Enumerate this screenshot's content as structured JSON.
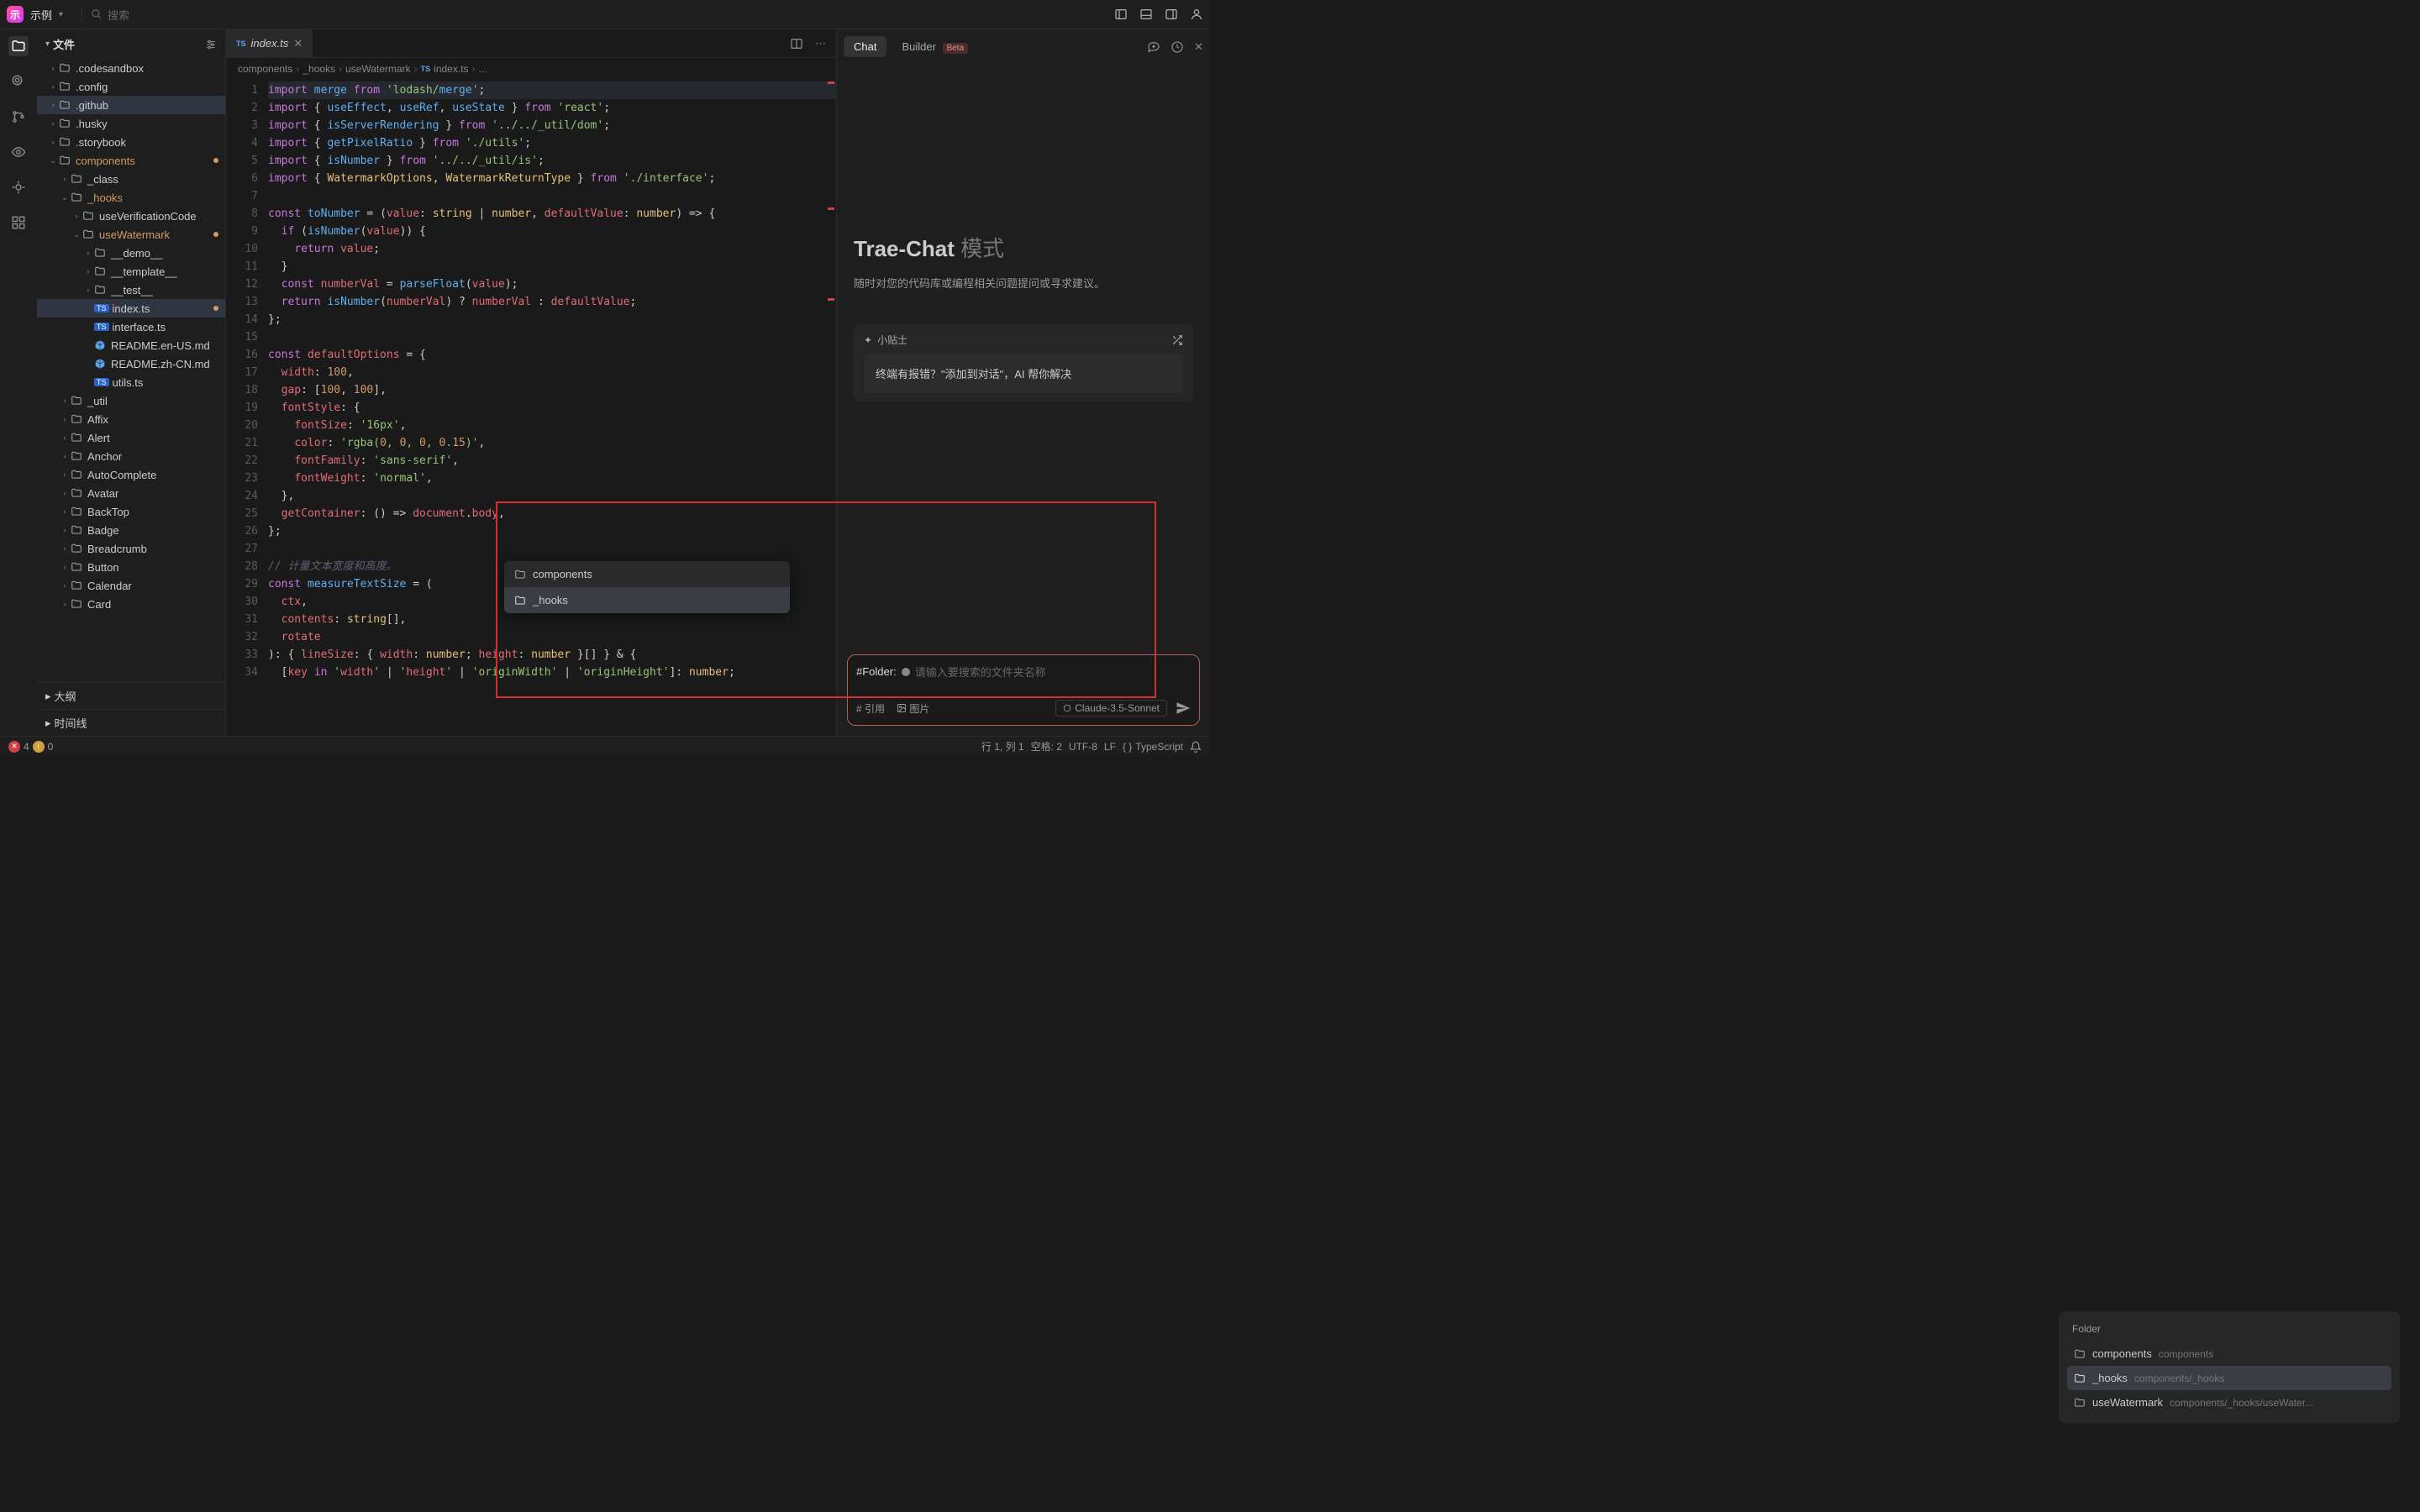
{
  "topbar": {
    "app_name": "示例",
    "search_placeholder": "搜索"
  },
  "sidebar": {
    "title": "文件",
    "tree": [
      {
        "type": "folder",
        "label": ".codesandbox",
        "depth": 0,
        "open": false
      },
      {
        "type": "folder",
        "label": ".config",
        "depth": 0,
        "open": false
      },
      {
        "type": "folder",
        "label": ".github",
        "depth": 0,
        "open": false,
        "selected": true
      },
      {
        "type": "folder",
        "label": ".husky",
        "depth": 0,
        "open": false
      },
      {
        "type": "folder",
        "label": ".storybook",
        "depth": 0,
        "open": false
      },
      {
        "type": "folder",
        "label": "components",
        "depth": 0,
        "open": true,
        "orange": true,
        "modified": true
      },
      {
        "type": "folder",
        "label": "_class",
        "depth": 1,
        "open": false
      },
      {
        "type": "folder",
        "label": "_hooks",
        "depth": 1,
        "open": true,
        "orange": true
      },
      {
        "type": "folder",
        "label": "useVerificationCode",
        "depth": 2,
        "open": false
      },
      {
        "type": "folder",
        "label": "useWatermark",
        "depth": 2,
        "open": true,
        "orange": true,
        "modified": true
      },
      {
        "type": "folder",
        "label": "__demo__",
        "depth": 3,
        "open": false
      },
      {
        "type": "folder",
        "label": "__template__",
        "depth": 3,
        "open": false
      },
      {
        "type": "folder",
        "label": "__test__",
        "depth": 3,
        "open": false
      },
      {
        "type": "file",
        "label": "index.ts",
        "depth": 3,
        "badge": "TS",
        "selected": true,
        "modified": true
      },
      {
        "type": "file",
        "label": "interface.ts",
        "depth": 3,
        "badge": "TS"
      },
      {
        "type": "file",
        "label": "README.en-US.md",
        "depth": 3,
        "icon": "md"
      },
      {
        "type": "file",
        "label": "README.zh-CN.md",
        "depth": 3,
        "icon": "md"
      },
      {
        "type": "file",
        "label": "utils.ts",
        "depth": 3,
        "badge": "TS"
      },
      {
        "type": "folder",
        "label": "_util",
        "depth": 1,
        "open": false
      },
      {
        "type": "folder",
        "label": "Affix",
        "depth": 1,
        "open": false
      },
      {
        "type": "folder",
        "label": "Alert",
        "depth": 1,
        "open": false
      },
      {
        "type": "folder",
        "label": "Anchor",
        "depth": 1,
        "open": false
      },
      {
        "type": "folder",
        "label": "AutoComplete",
        "depth": 1,
        "open": false
      },
      {
        "type": "folder",
        "label": "Avatar",
        "depth": 1,
        "open": false
      },
      {
        "type": "folder",
        "label": "BackTop",
        "depth": 1,
        "open": false
      },
      {
        "type": "folder",
        "label": "Badge",
        "depth": 1,
        "open": false
      },
      {
        "type": "folder",
        "label": "Breadcrumb",
        "depth": 1,
        "open": false
      },
      {
        "type": "folder",
        "label": "Button",
        "depth": 1,
        "open": false
      },
      {
        "type": "folder",
        "label": "Calendar",
        "depth": 1,
        "open": false
      },
      {
        "type": "folder",
        "label": "Card",
        "depth": 1,
        "open": false
      }
    ],
    "sections": {
      "outline": "大纲",
      "timeline": "时间线"
    }
  },
  "editor": {
    "tab": {
      "badge": "TS",
      "name": "index.ts"
    },
    "breadcrumbs": [
      "components",
      "_hooks",
      "useWatermark",
      "index.ts",
      "..."
    ],
    "lines": [
      "import merge from 'lodash/merge';",
      "import { useEffect, useRef, useState } from 'react';",
      "import { isServerRendering } from '../../_util/dom';",
      "import { getPixelRatio } from './utils';",
      "import { isNumber } from '../../_util/is';",
      "import { WatermarkOptions, WatermarkReturnType } from './interface';",
      "",
      "const toNumber = (value: string | number, defaultValue: number) => {",
      "  if (isNumber(value)) {",
      "    return value;",
      "  }",
      "  const numberVal = parseFloat(value);",
      "  return isNumber(numberVal) ? numberVal : defaultValue;",
      "};",
      "",
      "const defaultOptions = {",
      "  width: 100,",
      "  gap: [100, 100],",
      "  fontStyle: {",
      "    fontSize: '16px',",
      "    color: 'rgba(0, 0, 0, 0.15)',",
      "    fontFamily: 'sans-serif',",
      "    fontWeight: 'normal',",
      "  },",
      "  getContainer: () => document.body,",
      "};",
      "",
      "// 计量文本宽度和高度。",
      "const measureTextSize = (",
      "  ctx,",
      "  contents: string[],",
      "  rotate",
      "): { lineSize: { width: number; height: number }[] } & {",
      "  [key in 'width' | 'height' | 'originWidth' | 'originHeight']: number;"
    ]
  },
  "folder_popup": {
    "items": [
      {
        "label": "components",
        "selected": false
      },
      {
        "label": "_hooks",
        "selected": true
      }
    ]
  },
  "chat": {
    "tabs": {
      "chat": "Chat",
      "builder": "Builder",
      "beta": "Beta"
    },
    "heading": "Trae-Chat",
    "heading_mode": "模式",
    "subtitle": "随时对您的代码库或编程相关问题提问或寻求建议。",
    "tips_label": "小贴士",
    "tips_body": "终端有报错？\"添加到对话\"，AI 帮你解决",
    "folder_suggest": {
      "header": "Folder",
      "options": [
        {
          "name": "components",
          "path": "components"
        },
        {
          "name": "_hooks",
          "path": "components/_hooks",
          "selected": true
        },
        {
          "name": "useWatermark",
          "path": "components/_hooks/useWater..."
        }
      ]
    },
    "input": {
      "prefix": "#Folder:",
      "placeholder": "请输入要搜索的文件夹名称",
      "ref_label": "# 引用",
      "image_label": "图片",
      "model": "Claude-3.5-Sonnet"
    }
  },
  "statusbar": {
    "errors": "4",
    "warnings": "0",
    "line_col": "行 1, 列 1",
    "spaces": "空格: 2",
    "encoding": "UTF-8",
    "eol": "LF",
    "lang": "TypeScript"
  }
}
